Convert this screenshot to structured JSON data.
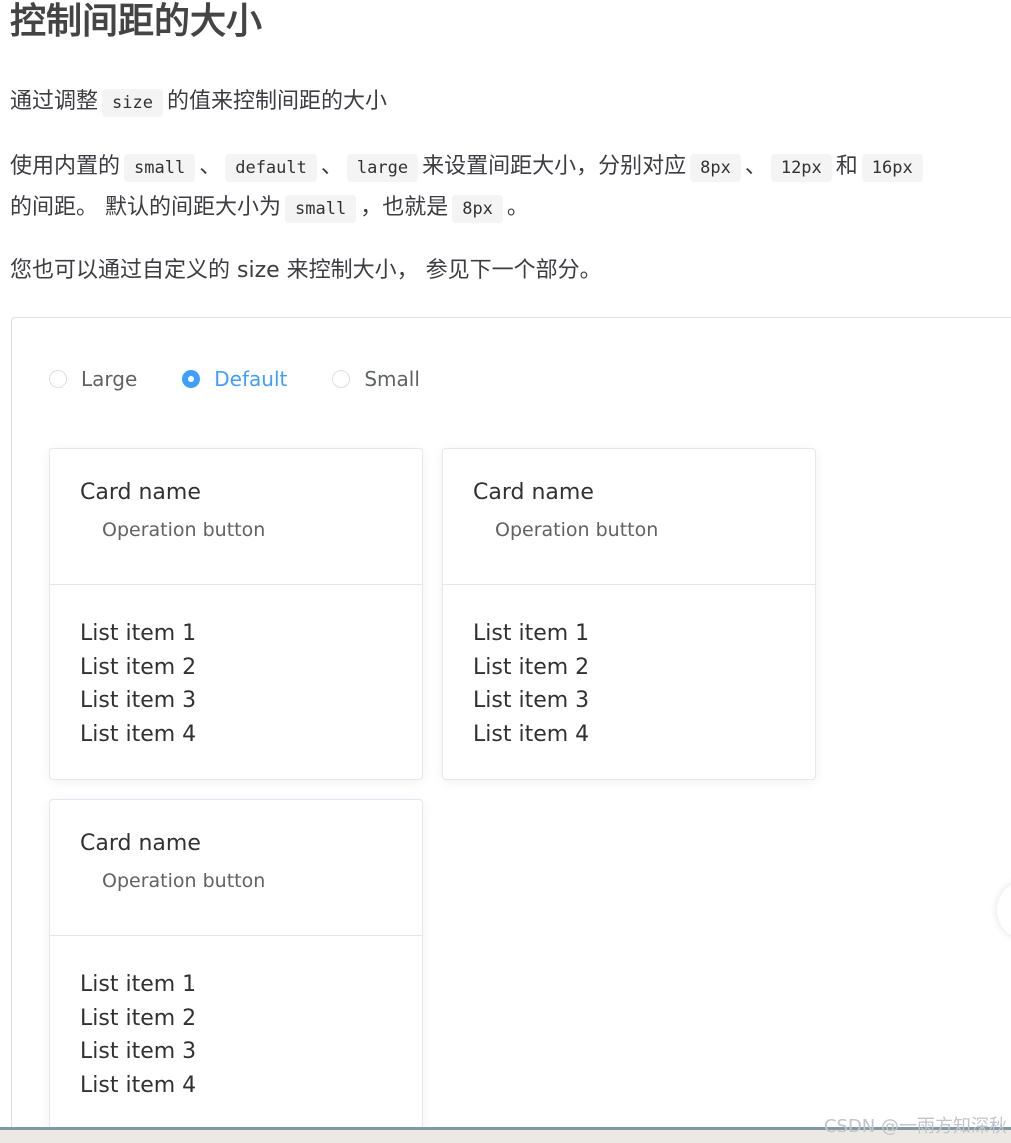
{
  "doc": {
    "title": "控制间距的大小",
    "p1": {
      "t1": "通过调整",
      "c1": "size",
      "t2": "的值来控制间距的大小"
    },
    "p2": {
      "t1": "使用内置的",
      "c1": "small",
      "s1": "、",
      "c2": "default",
      "s2": "、",
      "c3": "large",
      "t2": "来设置间距大小，分别对应",
      "c4": "8px",
      "s3": "、",
      "c5": "12px",
      "t3": "和",
      "c6": "16px",
      "t4": "的间距。 默认的间距大小为",
      "c7": "small",
      "t5": "，也就是",
      "c8": "8px",
      "t6": "。"
    },
    "p3": "您也可以通过自定义的 size 来控制大小， 参见下一个部分。"
  },
  "radios": [
    {
      "label": "Large",
      "checked": false
    },
    {
      "label": "Default",
      "checked": true
    },
    {
      "label": "Small",
      "checked": false
    }
  ],
  "cards": [
    {
      "title": "Card name",
      "button": "Operation button",
      "items": [
        "List item 1",
        "List item 2",
        "List item 3",
        "List item 4"
      ]
    },
    {
      "title": "Card name",
      "button": "Operation button",
      "items": [
        "List item 1",
        "List item 2",
        "List item 3",
        "List item 4"
      ]
    },
    {
      "title": "Card name",
      "button": "Operation button",
      "items": [
        "List item 1",
        "List item 2",
        "List item 3",
        "List item 4"
      ]
    }
  ],
  "watermark": "CSDN @一雨方知深秋",
  "colors": {
    "primary": "#409eff",
    "border": "#dcdfe6",
    "text": "#303133"
  }
}
